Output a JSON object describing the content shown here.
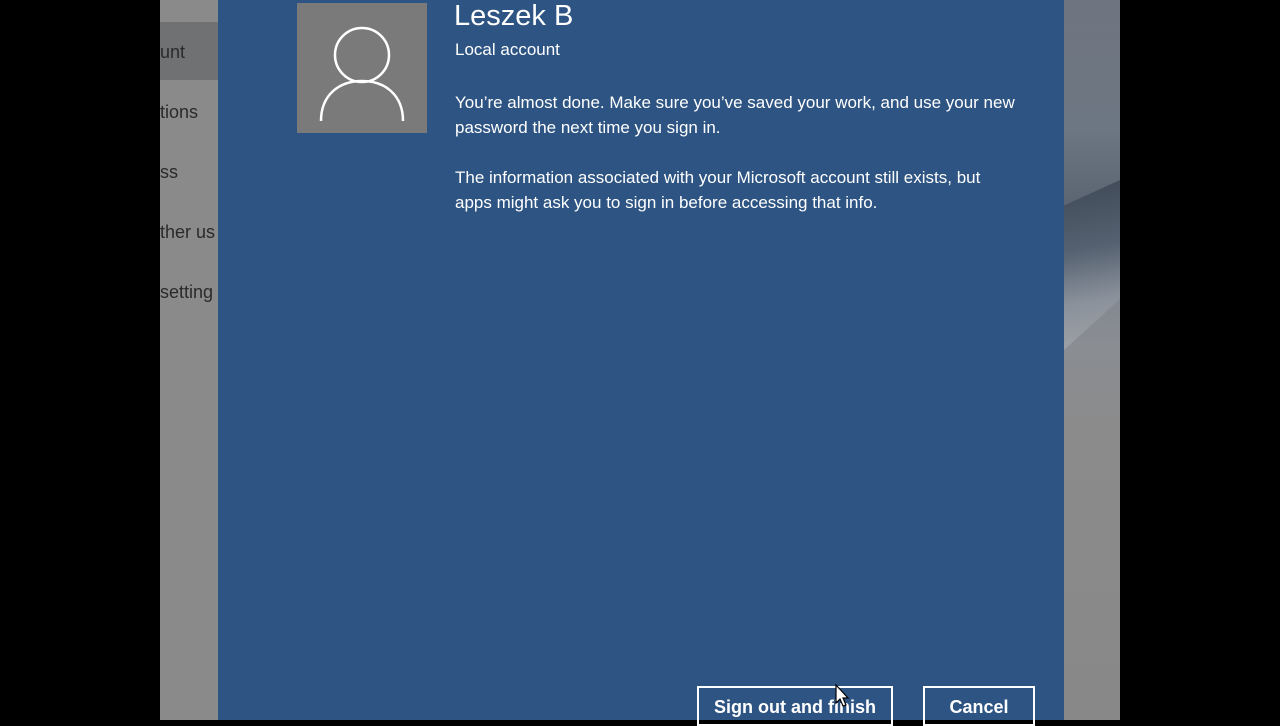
{
  "settings_nav": {
    "items": [
      "unt",
      "tions",
      "ss",
      "ther us",
      "setting"
    ]
  },
  "dialog": {
    "user_name": "Leszek B",
    "account_type": "Local account",
    "message_1": "You’re almost done. Make sure you’ve saved your work, and use your new password the next time you sign in.",
    "message_2": "The information associated with your Microsoft account still exists, but apps might ask you to sign in before accessing that info.",
    "buttons": {
      "sign_out": "Sign out and finish",
      "cancel": "Cancel"
    }
  },
  "colors": {
    "dialog_bg": "#2d5482",
    "avatar_bg": "#7a7a7a",
    "settings_bg": "#8a8a8a"
  },
  "icons": {
    "avatar": "user-silhouette-icon",
    "cursor": "mouse-pointer-icon"
  }
}
